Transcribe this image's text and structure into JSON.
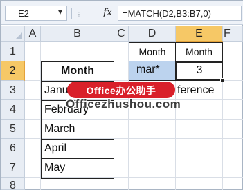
{
  "formula_bar": {
    "name_box": "E2",
    "dropdown_glyph": "▾",
    "grip_glyph": "⋮",
    "fx_label": "fx",
    "formula": "=MATCH(D2,B3:B7,0)"
  },
  "columns": [
    "A",
    "B",
    "C",
    "D",
    "E",
    "F"
  ],
  "selected_column": "E",
  "rows": [
    "1",
    "2",
    "3",
    "4",
    "5",
    "6",
    "7",
    "8"
  ],
  "selected_row": "2",
  "cells": {
    "D1": "Month",
    "E1": "Month",
    "D2": "mar*",
    "E2": "3",
    "E3_partial": "ference"
  },
  "month_table": {
    "header": "Month",
    "items": [
      "January",
      "February",
      "March",
      "April",
      "May"
    ]
  },
  "watermark": {
    "badge": "Office办公助手",
    "url": "Officezhushou.com"
  },
  "colors": {
    "selected_header": "#f6c866",
    "selected_cell_fill": "#bcd3ee",
    "watermark_red": "#d9202a"
  }
}
